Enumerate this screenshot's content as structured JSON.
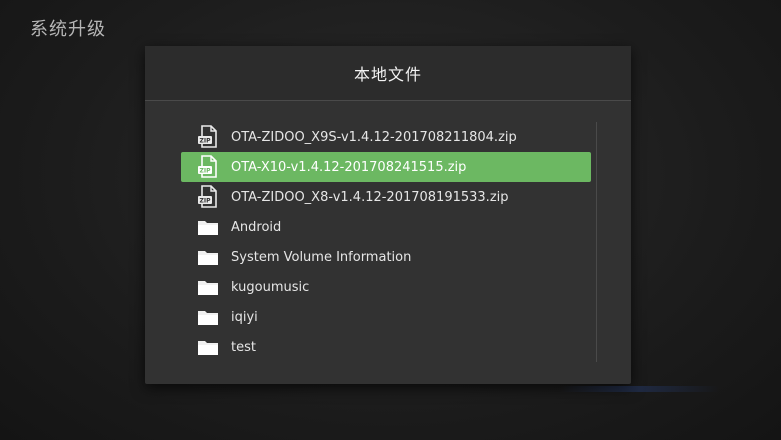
{
  "page": {
    "title": "系统升级"
  },
  "dialog": {
    "title": "本地文件",
    "files": [
      {
        "name": "OTA-ZIDOO_X9S-v1.4.12-201708211804.zip",
        "type": "zip",
        "selected": false
      },
      {
        "name": "OTA-X10-v1.4.12-201708241515.zip",
        "type": "zip",
        "selected": true
      },
      {
        "name": "OTA-ZIDOO_X8-v1.4.12-201708191533.zip",
        "type": "zip",
        "selected": false
      },
      {
        "name": "Android",
        "type": "folder",
        "selected": false
      },
      {
        "name": "System Volume Information",
        "type": "folder",
        "selected": false
      },
      {
        "name": "kugoumusic",
        "type": "folder",
        "selected": false
      },
      {
        "name": "iqiyi",
        "type": "folder",
        "selected": false
      },
      {
        "name": "test",
        "type": "folder",
        "selected": false
      }
    ]
  },
  "icons": {
    "zip": "zip-file-icon",
    "folder": "folder-icon",
    "zip_label": "ZIP"
  },
  "colors": {
    "selected": "#6cb862"
  }
}
